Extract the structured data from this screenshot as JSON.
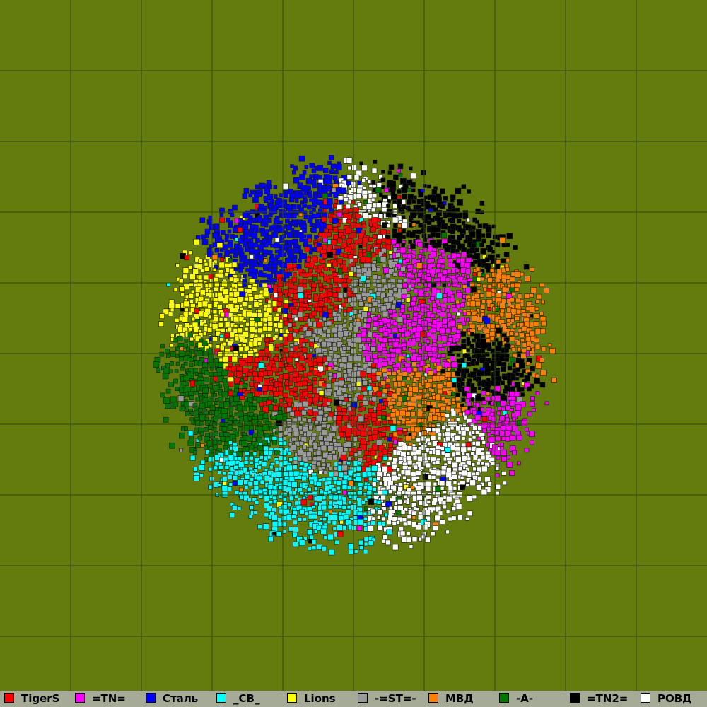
{
  "map": {
    "background": "#647b0d",
    "grid_line_color": "#2f4a0a",
    "grid_cells": 10,
    "territory_shape": "circular cluster of colored blocks"
  },
  "clans": [
    {
      "name": "TigerS",
      "color": "#ff0000"
    },
    {
      "name": "=TN=",
      "color": "#ff00ff"
    },
    {
      "name": "Сталь",
      "color": "#0000ff"
    },
    {
      "name": "_CB_",
      "color": "#00ffff"
    },
    {
      "name": "Lions",
      "color": "#ffff00"
    },
    {
      "name": "-=ST=-",
      "color": "#999999"
    },
    {
      "name": "МВД",
      "color": "#ff8000"
    },
    {
      "name": "-A-",
      "color": "#007700"
    },
    {
      "name": "=TN2=",
      "color": "#000000"
    },
    {
      "name": "РОВД",
      "color": "#ffffff"
    }
  ]
}
